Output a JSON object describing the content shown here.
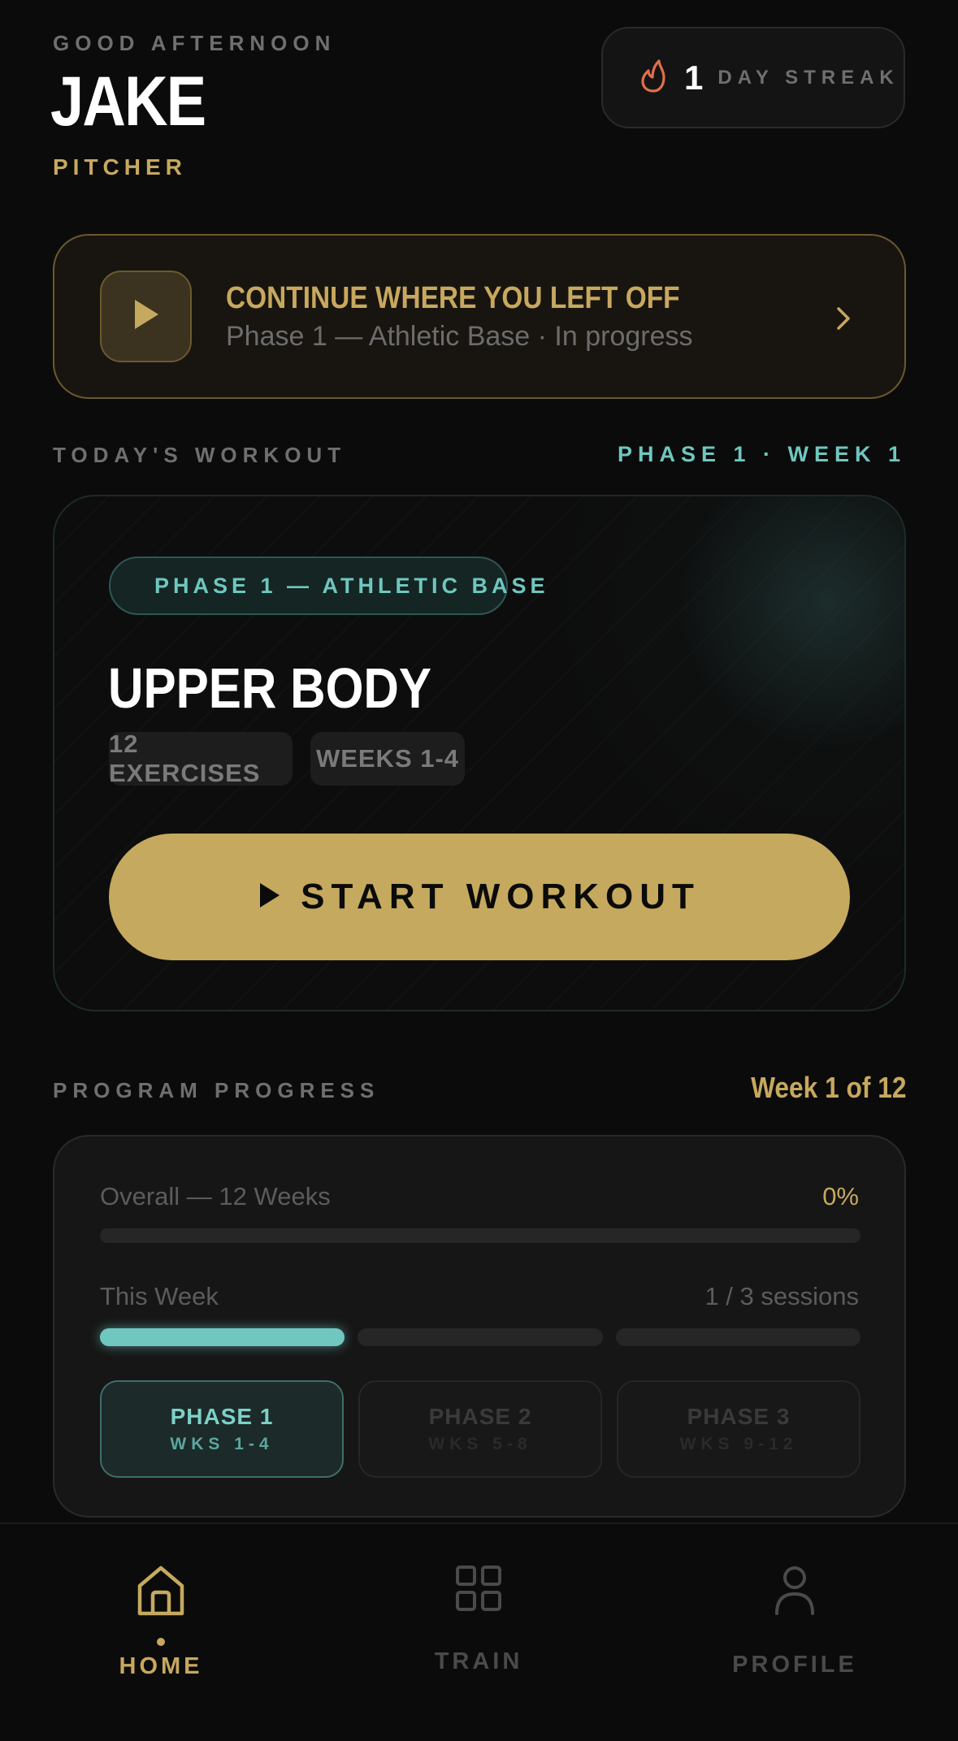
{
  "header": {
    "greeting": "GOOD AFTERNOON",
    "name": "JAKE",
    "role": "PITCHER",
    "streak": {
      "count": "1",
      "label": "DAY STREAK",
      "icon": "flame-icon"
    }
  },
  "continue_card": {
    "title": "CONTINUE WHERE YOU LEFT OFF",
    "subtitle": "Phase 1 — Athletic Base · In progress",
    "icon": "play-icon"
  },
  "todays_workout": {
    "section_label": "TODAY'S WORKOUT",
    "phase_week": "PHASE 1 · WEEK 1",
    "badge": "PHASE 1 — ATHLETIC BASE",
    "title": "UPPER BODY",
    "chips": [
      "12 EXERCISES",
      "WEEKS 1-4"
    ],
    "start_label": "START WORKOUT"
  },
  "program_progress": {
    "section_label": "PROGRAM PROGRESS",
    "week_of": "Week 1 of 12",
    "overall_label": "Overall — 12 Weeks",
    "overall_value": "0%",
    "overall_fraction": 0,
    "week_label": "This Week",
    "week_value": "1 / 3 sessions",
    "sessions_done": 1,
    "sessions_total": 3,
    "phases": [
      {
        "name": "PHASE 1",
        "weeks": "WKS 1-4",
        "active": true
      },
      {
        "name": "PHASE 2",
        "weeks": "WKS 5-8",
        "active": false
      },
      {
        "name": "PHASE 3",
        "weeks": "WKS 9-12",
        "active": false
      }
    ]
  },
  "nav": [
    {
      "label": "HOME",
      "icon": "home-icon",
      "active": true
    },
    {
      "label": "TRAIN",
      "icon": "grid-icon",
      "active": false
    },
    {
      "label": "PROFILE",
      "icon": "user-icon",
      "active": false
    }
  ],
  "colors": {
    "accent_gold": "#c5a95e",
    "accent_teal": "#6fc7bf",
    "streak_flame": "#e0704a",
    "background": "#0b0b0b"
  }
}
